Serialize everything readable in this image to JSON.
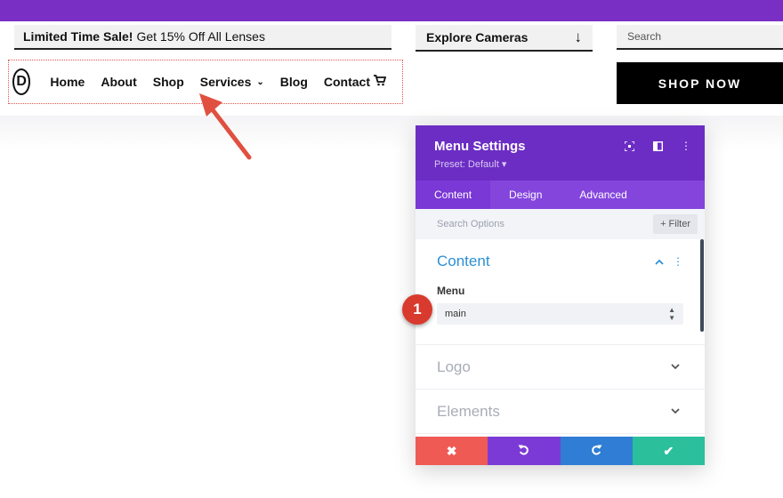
{
  "header": {
    "sale_bold": "Limited Time Sale!",
    "sale_text": "Get 15% Off All Lenses",
    "explore_label": "Explore Cameras",
    "search_placeholder": "Search",
    "shop_now_label": "SHOP NOW"
  },
  "nav": {
    "logo_letter": "D",
    "items": [
      "Home",
      "About",
      "Shop",
      "Services",
      "Blog",
      "Contact"
    ]
  },
  "panel": {
    "title": "Menu Settings",
    "preset": "Preset: Default ▾",
    "tabs": [
      "Content",
      "Design",
      "Advanced"
    ],
    "active_tab": "Content",
    "search_placeholder": "Search Options",
    "filter_label": "+ Filter",
    "sections": {
      "content": {
        "title": "Content",
        "field_label": "Menu",
        "select_value": "main"
      },
      "logo": {
        "title": "Logo"
      },
      "elements": {
        "title": "Elements"
      }
    }
  },
  "annotations": {
    "badge_number": "1"
  },
  "colors": {
    "brand_purple": "#7a2fc4",
    "panel_header": "#6c2dc4",
    "tabs_bar": "#8445dd",
    "section_accent": "#2d8fd5",
    "cancel": "#ef5a55",
    "undo": "#7b3ad6",
    "redo": "#2f7dd4",
    "save": "#2bbf9c",
    "callout": "#e05040"
  },
  "icons": {
    "explore": "arrow-down-icon",
    "cart": "cart-icon",
    "cancel": "close-icon",
    "undo": "undo-icon",
    "redo": "redo-icon",
    "save": "check-icon"
  }
}
